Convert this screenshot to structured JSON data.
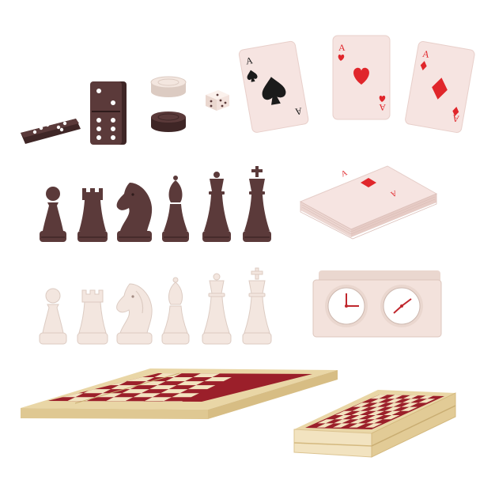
{
  "colors": {
    "background": "#ffffff",
    "dark_piece": "#5b3a3a",
    "dark_piece_shade": "#3f2626",
    "light_piece": "#f3e6df",
    "light_piece_shade": "#dccbc2",
    "card_face": "#f6e4e1",
    "card_red": "#e0262b",
    "card_black": "#1b1b1b",
    "board_light": "#f2e3c0",
    "board_dark": "#9b1f2a",
    "board_edge": "#e9d6a6",
    "clock_body": "#f3e2dc"
  },
  "cards": {
    "rank": "A"
  }
}
